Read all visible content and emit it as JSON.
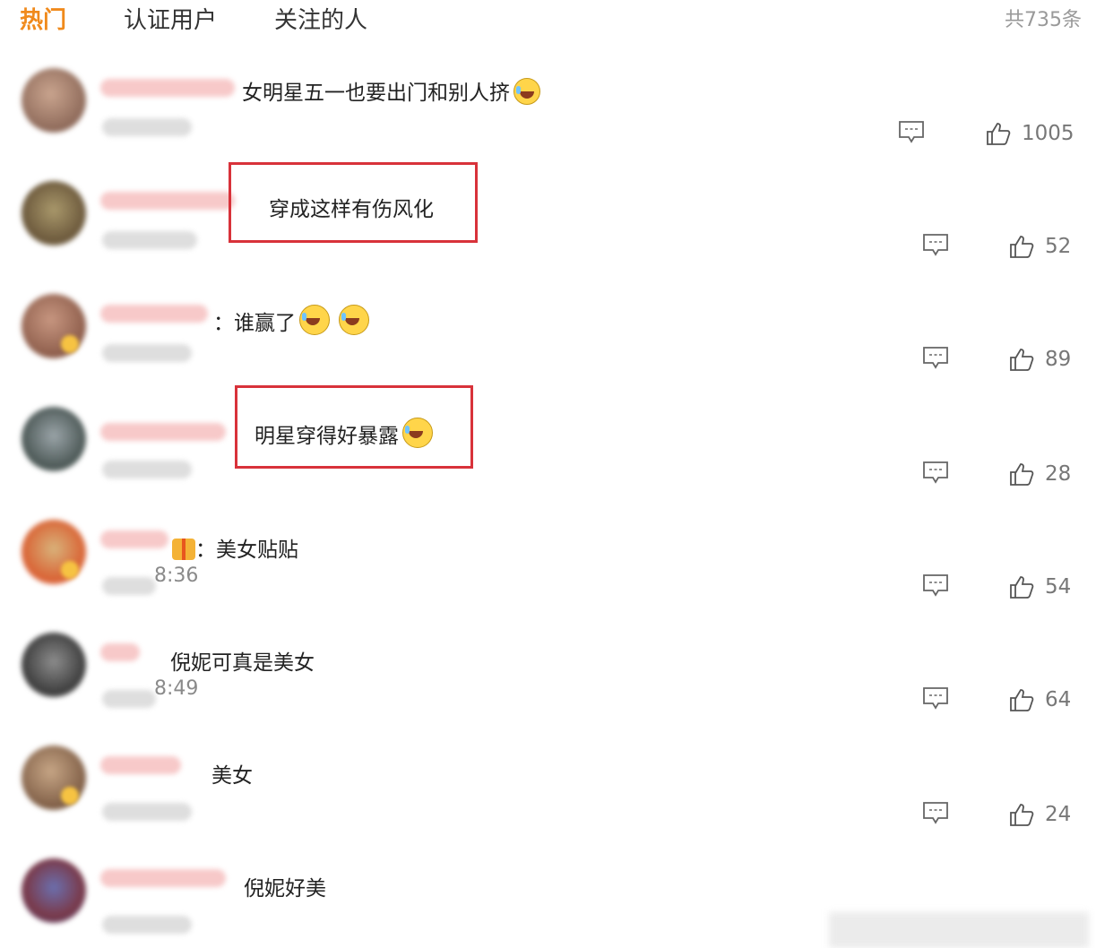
{
  "tabs": [
    {
      "label": "热门"
    },
    {
      "label": "认证用户"
    },
    {
      "label": "关注的人"
    }
  ],
  "total": "共735条",
  "colors": {
    "accent": "#f08a1c",
    "highlight_border": "#d8323a"
  },
  "comments": [
    {
      "text": "女明星五一也要出门和别人挤",
      "emoji": "crying-laughing-emoji",
      "time_tail": "",
      "likes": "1005",
      "highlighted": false
    },
    {
      "text": "穿成这样有伤风化",
      "emoji": "",
      "time_tail": "",
      "likes": "52",
      "highlighted": true
    },
    {
      "text": "：谁赢了",
      "emoji": "laughing-emoji x2",
      "time_tail": "",
      "likes": "89",
      "highlighted": false
    },
    {
      "text": "明星穿得好暴露",
      "emoji": "crying-laughing-emoji",
      "time_tail": "",
      "likes": "28",
      "highlighted": true
    },
    {
      "text": "：美女贴贴",
      "emoji": "",
      "time_tail": "8:36",
      "likes": "54",
      "highlighted": false
    },
    {
      "text": "倪妮可真是美女",
      "emoji": "",
      "time_tail": "8:49",
      "likes": "64",
      "highlighted": false
    },
    {
      "text": "美女",
      "emoji": "",
      "time_tail": "",
      "likes": "24",
      "highlighted": false
    },
    {
      "text": "倪妮好美",
      "emoji": "",
      "time_tail": "",
      "likes": "",
      "highlighted": false
    }
  ],
  "icons": {
    "reply": "comment-icon",
    "like": "thumbs-up-icon"
  }
}
